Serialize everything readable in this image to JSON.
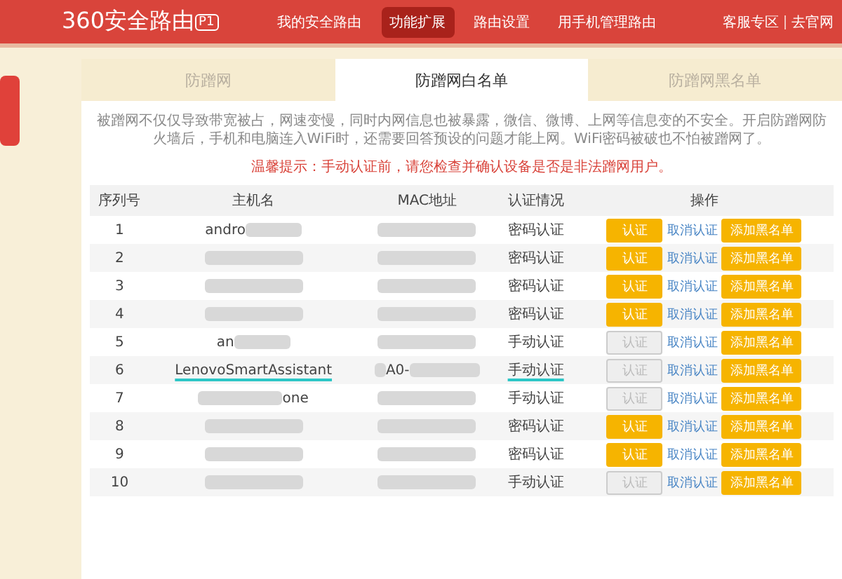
{
  "header": {
    "logo": "360安全路由",
    "model_badge": "P1",
    "nav": [
      {
        "label": "我的安全路由",
        "selected": false
      },
      {
        "label": "功能扩展",
        "selected": true
      },
      {
        "label": "路由设置",
        "selected": false
      },
      {
        "label": "用手机管理路由",
        "selected": false
      }
    ],
    "links": [
      "客服专区",
      "去官网"
    ]
  },
  "tabs": [
    {
      "label": "防蹭网",
      "selected": false
    },
    {
      "label": "防蹭网白名单",
      "selected": true
    },
    {
      "label": "防蹭网黑名单",
      "selected": false
    }
  ],
  "description": "被蹭网不仅仅导致带宽被占，网速变慢，同时内网信息也被暴露，微信、微博、上网等信息变的不安全。开启防蹭网防火墙后，手机和电脑连入WiFi时，还需要回答预设的问题才能上网。WiFi密码被破也不怕被蹭网了。",
  "tip": "温馨提示：手动认证前，请您检查并确认设备是否是非法蹭网用户。",
  "table": {
    "columns": [
      "序列号",
      "主机名",
      "MAC地址",
      "认证情况",
      "操作"
    ],
    "rows": [
      {
        "index": "1",
        "host": {
          "text": "andro",
          "blur_before": false,
          "blur_after": true
        },
        "mac": {
          "blur_before": false,
          "blur_after": true
        },
        "auth": "密码认证",
        "auth_button": {
          "label": "认证",
          "disabled": false
        },
        "cancel": "取消认证",
        "blacklist": "添加黑名单",
        "marked": false
      },
      {
        "index": "2",
        "host": {
          "blur_before": false,
          "blur_after": true
        },
        "mac": {
          "blur_before": false,
          "blur_after": true
        },
        "auth": "密码认证",
        "auth_button": {
          "label": "认证",
          "disabled": false
        },
        "cancel": "取消认证",
        "blacklist": "添加黑名单",
        "marked": false
      },
      {
        "index": "3",
        "host": {
          "blur_before": false,
          "blur_after": true
        },
        "mac": {
          "blur_before": false,
          "blur_after": true
        },
        "auth": "密码认证",
        "auth_button": {
          "label": "认证",
          "disabled": false
        },
        "cancel": "取消认证",
        "blacklist": "添加黑名单",
        "marked": false
      },
      {
        "index": "4",
        "host": {
          "blur_before": false,
          "blur_after": true
        },
        "mac": {
          "blur_before": false,
          "blur_after": true
        },
        "auth": "密码认证",
        "auth_button": {
          "label": "认证",
          "disabled": false
        },
        "cancel": "取消认证",
        "blacklist": "添加黑名单",
        "marked": false
      },
      {
        "index": "5",
        "host": {
          "text": "an",
          "blur_before": false,
          "blur_after": true
        },
        "mac": {
          "blur_before": false,
          "blur_after": true
        },
        "auth": "手动认证",
        "auth_button": {
          "label": "认证",
          "disabled": true
        },
        "cancel": "取消认证",
        "blacklist": "添加黑名单",
        "marked": false
      },
      {
        "index": "6",
        "host": {
          "text": "LenovoSmartAssistant",
          "blur_before": false,
          "blur_after": false
        },
        "mac": {
          "text": "A0-",
          "blur_before": true,
          "blur_after": true
        },
        "auth": "手动认证",
        "auth_button": {
          "label": "认证",
          "disabled": true
        },
        "cancel": "取消认证",
        "blacklist": "添加黑名单",
        "marked": true
      },
      {
        "index": "7",
        "host": {
          "text": "one",
          "blur_before": true,
          "blur_after": false
        },
        "mac": {
          "blur_before": false,
          "blur_after": true
        },
        "auth": "手动认证",
        "auth_button": {
          "label": "认证",
          "disabled": true
        },
        "cancel": "取消认证",
        "blacklist": "添加黑名单",
        "marked": false
      },
      {
        "index": "8",
        "host": {
          "blur_before": false,
          "blur_after": true
        },
        "mac": {
          "blur_before": false,
          "blur_after": true
        },
        "auth": "密码认证",
        "auth_button": {
          "label": "认证",
          "disabled": false
        },
        "cancel": "取消认证",
        "blacklist": "添加黑名单",
        "marked": false
      },
      {
        "index": "9",
        "host": {
          "blur_before": false,
          "blur_after": true
        },
        "mac": {
          "blur_before": false,
          "blur_after": true
        },
        "auth": "密码认证",
        "auth_button": {
          "label": "认证",
          "disabled": false
        },
        "cancel": "取消认证",
        "blacklist": "添加黑名单",
        "marked": false
      },
      {
        "index": "10",
        "host": {
          "blur_before": false,
          "blur_after": true
        },
        "mac": {
          "blur_before": false,
          "blur_after": true
        },
        "auth": "手动认证",
        "auth_button": {
          "label": "认证",
          "disabled": true
        },
        "cancel": "取消认证",
        "blacklist": "添加黑名单",
        "marked": false
      }
    ]
  }
}
